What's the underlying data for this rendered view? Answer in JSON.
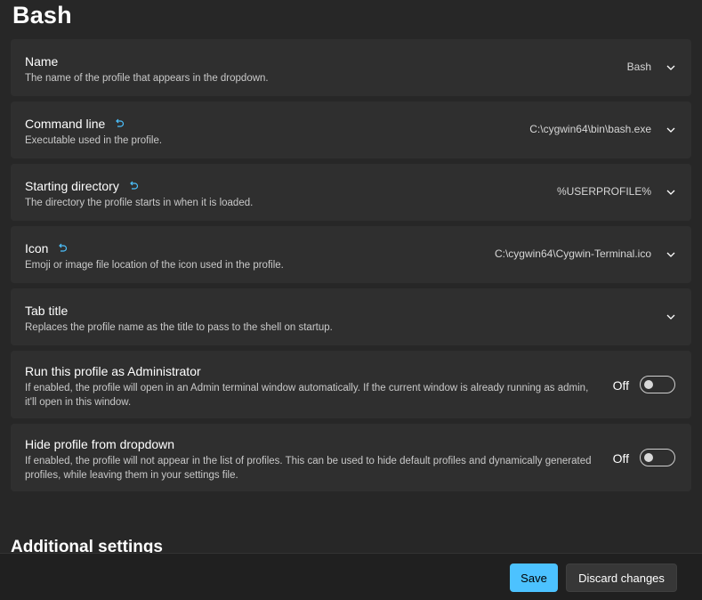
{
  "page": {
    "title": "Bash"
  },
  "settings": [
    {
      "title": "Name",
      "description": "The name of the profile that appears in the dropdown.",
      "value": "Bash",
      "has_reset": false
    },
    {
      "title": "Command line",
      "description": "Executable used in the profile.",
      "value": "C:\\cygwin64\\bin\\bash.exe",
      "has_reset": true
    },
    {
      "title": "Starting directory",
      "description": "The directory the profile starts in when it is loaded.",
      "value": "%USERPROFILE%",
      "has_reset": true
    },
    {
      "title": "Icon",
      "description": "Emoji or image file location of the icon used in the profile.",
      "value": "C:\\cygwin64\\Cygwin-Terminal.ico",
      "has_reset": true
    },
    {
      "title": "Tab title",
      "description": "Replaces the profile name as the title to pass to the shell on startup.",
      "value": "",
      "has_reset": false
    }
  ],
  "toggles": [
    {
      "title": "Run this profile as Administrator",
      "description": "If enabled, the profile will open in an Admin terminal window automatically. If the current window is already running as admin, it'll open in this window.",
      "state_label": "Off",
      "enabled": false
    },
    {
      "title": "Hide profile from dropdown",
      "description": "If enabled, the profile will not appear in the list of profiles. This can be used to hide default profiles and dynamically generated profiles, while leaving them in your settings file.",
      "state_label": "Off",
      "enabled": false
    }
  ],
  "section": {
    "additional_settings_heading": "Additional settings"
  },
  "footer": {
    "save_label": "Save",
    "discard_label": "Discard changes"
  },
  "icons": {
    "reset": "reset-icon",
    "chevron": "chevron-down-icon"
  },
  "colors": {
    "background": "#272727",
    "card": "#2f2f2f",
    "accent": "#4cc2ff",
    "reset_icon": "#4cc2ff"
  }
}
